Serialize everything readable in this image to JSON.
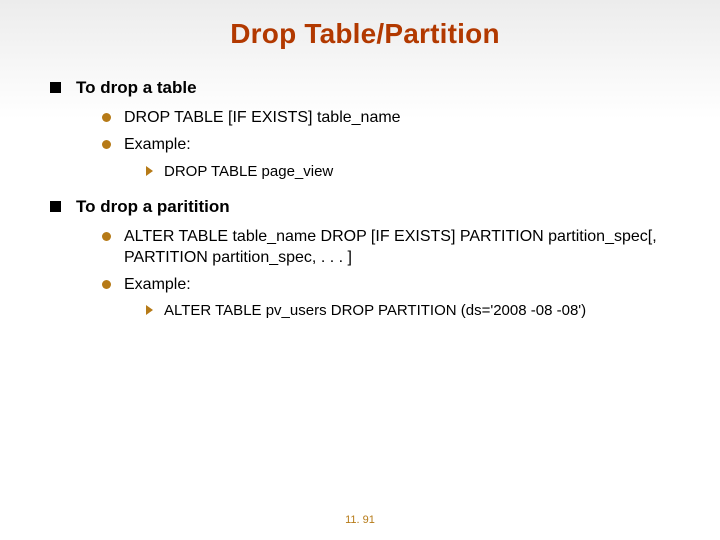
{
  "title": "Drop Table/Partition",
  "sections": [
    {
      "heading": "To drop a table",
      "items": [
        {
          "text": "DROP TABLE [IF EXISTS] table_name"
        },
        {
          "text": "Example:",
          "sub": [
            {
              "text": "DROP TABLE page_view"
            }
          ]
        }
      ]
    },
    {
      "heading": "To drop a paritition",
      "items": [
        {
          "text": "ALTER TABLE table_name DROP [IF EXISTS] PARTITION partition_spec[, PARTITION partition_spec, . . . ]"
        },
        {
          "text": "Example:",
          "sub": [
            {
              "text": "ALTER TABLE pv_users DROP PARTITION (ds='2008 -08 -08')"
            }
          ]
        }
      ]
    }
  ],
  "page_number": "11. 91"
}
